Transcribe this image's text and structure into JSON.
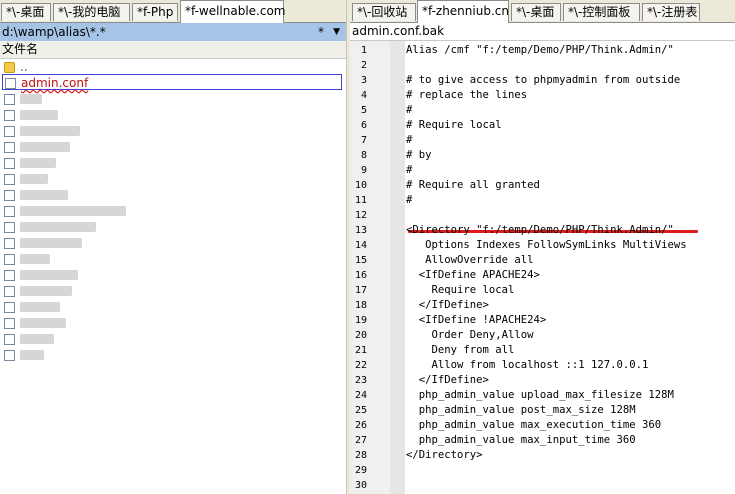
{
  "left_panel": {
    "tabs": [
      "*\\-桌面",
      "*\\-我的电脑",
      "*f-Php",
      "*f-wellnable.com"
    ],
    "active_tab": 3,
    "path": "d:\\wamp\\alias\\*.*",
    "filter_star": "*",
    "column_header": "文件名",
    "parent_entry": "..",
    "selected_file": "admin.conf"
  },
  "right_panel": {
    "tabs": [
      "*\\-回收站",
      "*f-zhenniub.cn",
      "*\\-桌面",
      "*\\-控制面板",
      "*\\-注册表"
    ],
    "active_tab": 1,
    "file_title": "admin.conf.bak",
    "lines": [
      "Alias /cmf \"f:/temp/Demo/PHP/Think.Admin/\"",
      "",
      "# to give access to phpmyadmin from outside",
      "# replace the lines",
      "#",
      "# Require local",
      "#",
      "# by",
      "#",
      "# Require all granted",
      "#",
      "",
      "<Directory \"f:/temp/Demo/PHP/Think.Admin/\"",
      "   Options Indexes FollowSymLinks MultiViews",
      "   AllowOverride all",
      "  <IfDefine APACHE24>",
      "    Require local",
      "  </IfDefine>",
      "  <IfDefine !APACHE24>",
      "    Order Deny,Allow",
      "    Deny from all",
      "    Allow from localhost ::1 127.0.0.1",
      "  </IfDefine>",
      "  php_admin_value upload_max_filesize 128M",
      "  php_admin_value post_max_size 128M",
      "  php_admin_value max_execution_time 360",
      "  php_admin_value max_input_time 360",
      "</Directory>",
      "",
      ""
    ]
  },
  "colors": {
    "path_bar": "#a6c4e6",
    "annotation_red": "#e01b1b",
    "selection_border": "#3c43d6"
  }
}
